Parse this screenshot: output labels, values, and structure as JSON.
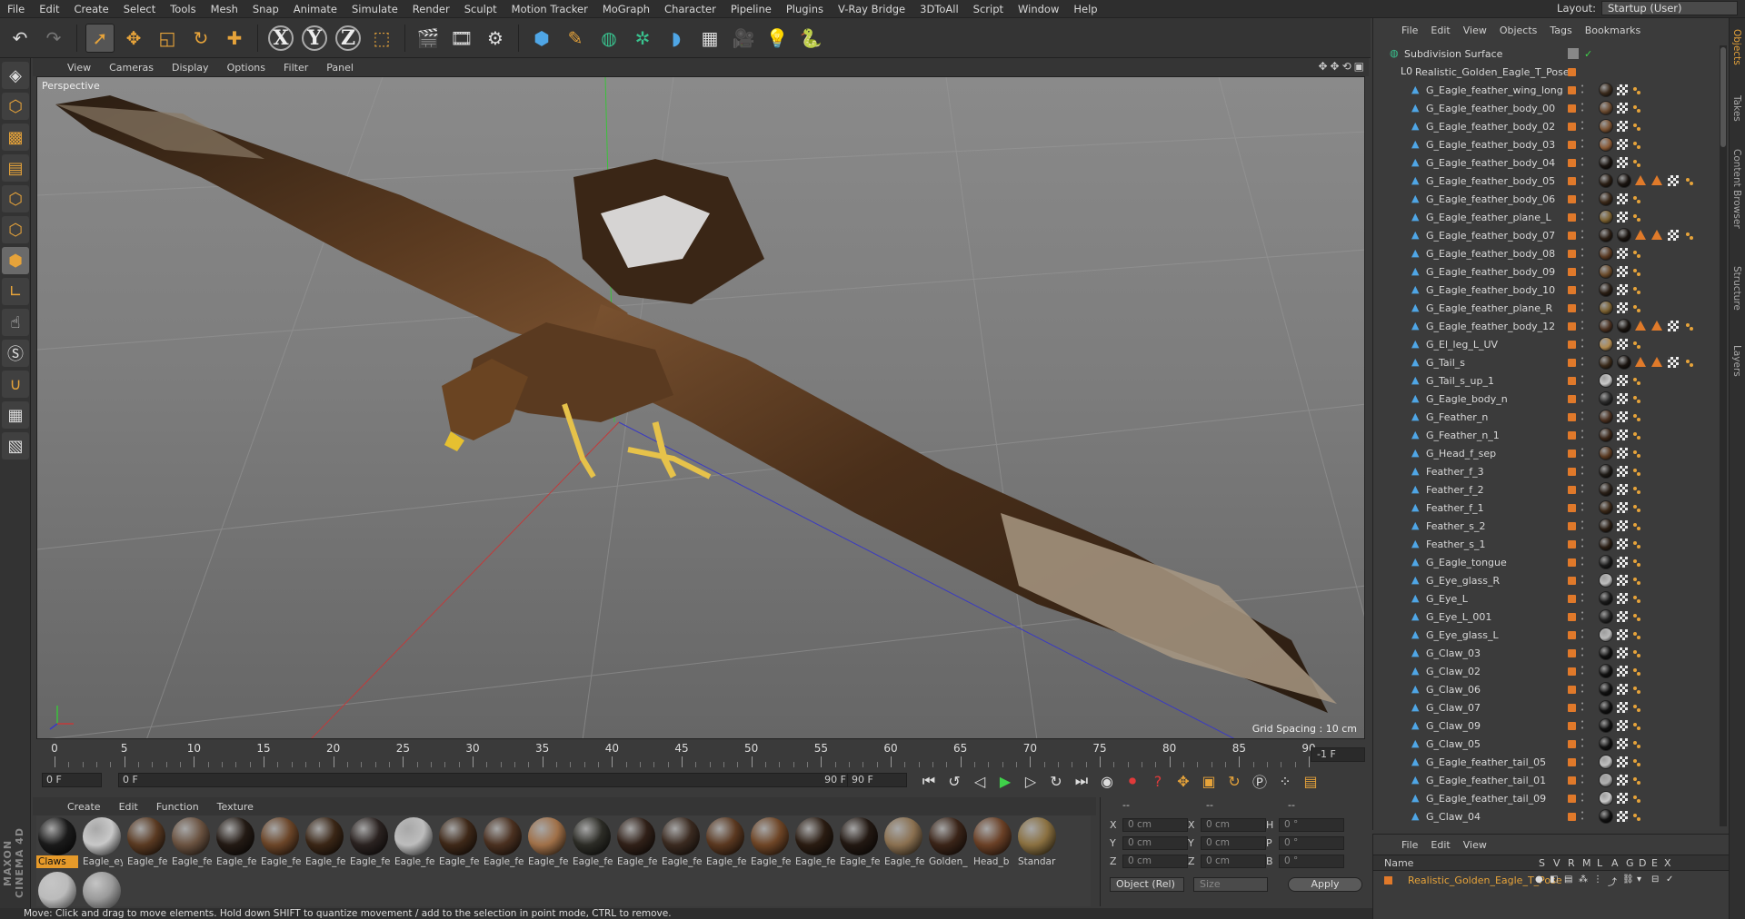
{
  "menubar": {
    "items": [
      "File",
      "Edit",
      "Create",
      "Select",
      "Tools",
      "Mesh",
      "Snap",
      "Animate",
      "Simulate",
      "Render",
      "Sculpt",
      "Motion Tracker",
      "MoGraph",
      "Character",
      "Pipeline",
      "Plugins",
      "V-Ray Bridge",
      "3DToAll",
      "Script",
      "Window",
      "Help"
    ],
    "layout_label": "Layout:",
    "layout_value": "Startup (User)"
  },
  "viewport": {
    "menu": [
      "View",
      "Cameras",
      "Display",
      "Options",
      "Filter",
      "Panel"
    ],
    "label": "Perspective",
    "grid_spacing": "Grid Spacing : 10 cm"
  },
  "timeline": {
    "ticks": [
      "0",
      "5",
      "10",
      "15",
      "20",
      "25",
      "30",
      "35",
      "40",
      "45",
      "50",
      "55",
      "60",
      "65",
      "70",
      "75",
      "80",
      "85",
      "90"
    ],
    "end_field": "-1 F",
    "current_frame": "0 F",
    "range_start": "0 F",
    "range_end": "90 F",
    "max_frame": "90 F"
  },
  "materials": {
    "menu": [
      "Create",
      "Edit",
      "Function",
      "Texture"
    ],
    "items": [
      {
        "label": "Claws",
        "color": "#1a1a1a",
        "hl": true
      },
      {
        "label": "Eagle_ey",
        "color": "#c8c8c8"
      },
      {
        "label": "Eagle_fe",
        "color": "#5a3a22"
      },
      {
        "label": "Eagle_fe",
        "color": "#6a5240"
      },
      {
        "label": "Eagle_fe",
        "color": "#231a14"
      },
      {
        "label": "Eagle_fe",
        "color": "#6b4528"
      },
      {
        "label": "Eagle_fe",
        "color": "#3a2616"
      },
      {
        "label": "Eagle_fe",
        "color": "#2a2220"
      },
      {
        "label": "Eagle_fe",
        "color": "#bdbdbd"
      },
      {
        "label": "Eagle_fe",
        "color": "#3e2818"
      },
      {
        "label": "Eagle_fe",
        "color": "#4a3020"
      },
      {
        "label": "Eagle_fe",
        "color": "#a07048"
      },
      {
        "label": "Eagle_fe",
        "color": "#2c2c26"
      },
      {
        "label": "Eagle_fe",
        "color": "#302018"
      },
      {
        "label": "Eagle_fe",
        "color": "#3a2a20"
      },
      {
        "label": "Eagle_fe",
        "color": "#5a3820"
      },
      {
        "label": "Eagle_fe",
        "color": "#6e4526"
      },
      {
        "label": "Eagle_fe",
        "color": "#2a1c12"
      },
      {
        "label": "Eagle_fe",
        "color": "#221812"
      },
      {
        "label": "Eagle_fe",
        "color": "#8a7050"
      },
      {
        "label": "Golden_",
        "color": "#3a2418"
      },
      {
        "label": "Head_b",
        "color": "#6a4026"
      },
      {
        "label": "Standar",
        "color": "#8a7040"
      }
    ],
    "row2": [
      {
        "color": "#bbbbbb"
      },
      {
        "color": "#9a9a9a"
      }
    ]
  },
  "coords": {
    "header_left": "--",
    "header_mid": "--",
    "header_right": "--",
    "rows": [
      {
        "a": "X",
        "av": "0 cm",
        "b": "X",
        "bv": "0 cm",
        "c": "H",
        "cv": "0 °"
      },
      {
        "a": "Y",
        "av": "0 cm",
        "b": "Y",
        "bv": "0 cm",
        "c": "P",
        "cv": "0 °"
      },
      {
        "a": "Z",
        "av": "0 cm",
        "b": "Z",
        "bv": "0 cm",
        "c": "B",
        "cv": "0 °"
      }
    ],
    "mode": "Object (Rel)",
    "size": "Size",
    "apply": "Apply"
  },
  "status": "Move: Click and drag to move elements. Hold down SHIFT to quantize movement / add to the selection in point mode, CTRL to remove.",
  "objects": {
    "menu": [
      "File",
      "Edit",
      "View",
      "Objects",
      "Tags",
      "Bookmarks"
    ],
    "root": "Subdivision Surface",
    "group": "Realistic_Golden_Eagle_T_Pose",
    "children": [
      {
        "name": "G_Eagle_feather_wing_long",
        "extra": false,
        "t": "#3a2a1c"
      },
      {
        "name": "G_Eagle_feather_body_00",
        "extra": false,
        "t": "#6a4a30"
      },
      {
        "name": "G_Eagle_feather_body_02",
        "extra": false,
        "t": "#7a5232"
      },
      {
        "name": "G_Eagle_feather_body_03",
        "extra": false,
        "t": "#8a5a36"
      },
      {
        "name": "G_Eagle_feather_body_04",
        "extra": false,
        "t": "#1a1410"
      },
      {
        "name": "G_Eagle_feather_body_05",
        "extra": true,
        "t": "#2a1e14"
      },
      {
        "name": "G_Eagle_feather_body_06",
        "extra": false,
        "t": "#3a2818"
      },
      {
        "name": "G_Eagle_feather_plane_L",
        "extra": false,
        "t": "#7a6030"
      },
      {
        "name": "G_Eagle_feather_body_07",
        "extra": true,
        "t": "#2a1e14"
      },
      {
        "name": "G_Eagle_feather_body_08",
        "extra": false,
        "t": "#5a3a22"
      },
      {
        "name": "G_Eagle_feather_body_09",
        "extra": false,
        "t": "#6a4a2a"
      },
      {
        "name": "G_Eagle_feather_body_10",
        "extra": false,
        "t": "#2a1e14"
      },
      {
        "name": "G_Eagle_feather_plane_R",
        "extra": false,
        "t": "#7a6030"
      },
      {
        "name": "G_Eagle_feather_body_12",
        "extra": true,
        "t": "#4a3020"
      },
      {
        "name": "G_El_leg_L_UV",
        "extra": false,
        "t": "#b08a50"
      },
      {
        "name": "G_Tail_s",
        "extra": true,
        "t": "#3a2a1a"
      },
      {
        "name": "G_Tail_s_up_1",
        "extra": false,
        "t": "#c8c8c8"
      },
      {
        "name": "G_Eagle_body_n",
        "extra": false,
        "t": "#2a2a2a"
      },
      {
        "name": "G_Feather_n",
        "extra": false,
        "t": "#4a3020"
      },
      {
        "name": "G_Feather_n_1",
        "extra": false,
        "t": "#3a2618"
      },
      {
        "name": "G_Head_f_sep",
        "extra": false,
        "t": "#5a3a22"
      },
      {
        "name": "Feather_f_3",
        "extra": false,
        "t": "#1e1a16"
      },
      {
        "name": "Feather_f_2",
        "extra": false,
        "t": "#2a2018"
      },
      {
        "name": "Feather_f_1",
        "extra": false,
        "t": "#3a2818"
      },
      {
        "name": "Feather_s_2",
        "extra": false,
        "t": "#2a1e14"
      },
      {
        "name": "Feather_s_1",
        "extra": false,
        "t": "#2a1e14"
      },
      {
        "name": "G_Eagle_tongue",
        "extra": false,
        "t": "#1a1a1a"
      },
      {
        "name": "G_Eye_glass_R",
        "extra": false,
        "t": "#bdbdbd"
      },
      {
        "name": "G_Eye_L",
        "extra": false,
        "t": "#1a1a1a"
      },
      {
        "name": "G_Eye_L_001",
        "extra": false,
        "t": "#222"
      },
      {
        "name": "G_Eye_glass_L",
        "extra": false,
        "t": "#b8b8b8"
      },
      {
        "name": "G_Claw_03",
        "extra": false,
        "t": "#111"
      },
      {
        "name": "G_Claw_02",
        "extra": false,
        "t": "#111"
      },
      {
        "name": "G_Claw_06",
        "extra": false,
        "t": "#111"
      },
      {
        "name": "G_Claw_07",
        "extra": false,
        "t": "#111"
      },
      {
        "name": "G_Claw_09",
        "extra": false,
        "t": "#111"
      },
      {
        "name": "G_Claw_05",
        "extra": false,
        "t": "#111"
      },
      {
        "name": "G_Eagle_feather_tail_05",
        "extra": false,
        "t": "#c0c0c0"
      },
      {
        "name": "G_Eagle_feather_tail_01",
        "extra": false,
        "t": "#b0b0b0"
      },
      {
        "name": "G_Eagle_feather_tail_09",
        "extra": false,
        "t": "#c8c8c8"
      },
      {
        "name": "G_Claw_04",
        "extra": false,
        "t": "#111"
      }
    ]
  },
  "attributes": {
    "menu": [
      "File",
      "Edit",
      "View"
    ],
    "headers": [
      "Name",
      "S",
      "V",
      "R",
      "M",
      "L",
      "A",
      "G",
      "D",
      "E",
      "X"
    ],
    "row_name": "Realistic_Golden_Eagle_T_Pose"
  },
  "vtabs": [
    "Objects",
    "Takes",
    "Content Browser",
    "Structure",
    "Layers"
  ],
  "colors": {
    "accent": "#e6a33a",
    "select_orange": "#e0792a",
    "axis_x": "#c23a3a",
    "axis_y": "#3ac23a",
    "axis_z": "#3a3ac2"
  }
}
